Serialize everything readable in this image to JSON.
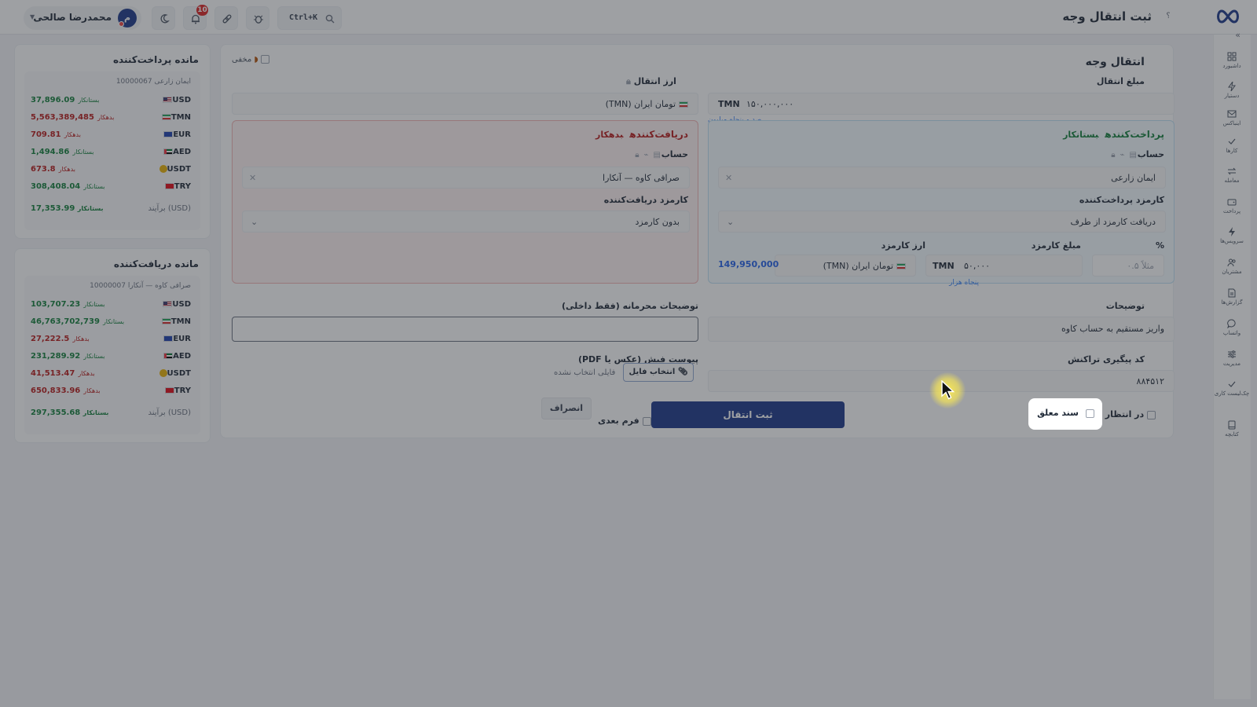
{
  "topbar": {
    "page_title": "ثبت انتقال وجه",
    "help": "؟",
    "search_shortcut": "Ctrl+K",
    "notifications_count": "10",
    "user_name": "محمدرضا صالحی",
    "user_initial": "م"
  },
  "nav": {
    "collapse": "«",
    "items": [
      {
        "label": "داشبورد",
        "icon": "dashboard-icon"
      },
      {
        "label": "دستیار",
        "icon": "bolt-icon"
      },
      {
        "label": "اینباکس",
        "icon": "inbox-icon"
      },
      {
        "label": "کارها",
        "icon": "check-icon"
      },
      {
        "label": "معامله",
        "icon": "exchange-icon"
      },
      {
        "label": "پرداخت",
        "icon": "wallet-icon"
      },
      {
        "label": "سرویس‌ها",
        "icon": "service-icon"
      },
      {
        "label": "مشتریان",
        "icon": "users-icon"
      },
      {
        "label": "گزارش‌ها",
        "icon": "report-icon"
      },
      {
        "label": "واتساپ",
        "icon": "chat-icon"
      },
      {
        "label": "مدیریت",
        "icon": "sliders-icon"
      },
      {
        "label": "چک‌لیست کاری",
        "icon": "checklist-icon"
      },
      {
        "label": "کتابچه",
        "icon": "book-icon"
      }
    ]
  },
  "form": {
    "title": "انتقال وجه",
    "hidden_label": "مخفی",
    "amount_label": "مبلغ انتقال",
    "amount_value": "۱۵۰,۰۰۰,۰۰۰",
    "amount_currency": "TMN",
    "amount_in_words": "صد و پنجاه میلیون",
    "currency_label": "ارز انتقال",
    "currency_value": "تومان ایران (TMN)",
    "payer": {
      "title": "پرداخت‌کننده",
      "status": "بستانکار",
      "account_label": "حساب",
      "account_value": "ایمان زارعی",
      "fee_label": "کارمزد پرداخت‌کننده",
      "fee_value": "دریافت کارمزد از طرف",
      "percent_label": "%",
      "percent_placeholder": "مثلاً ۰.۵",
      "fee_amount_label": "مبلغ کارمزد",
      "fee_amount_value": "۵۰,۰۰۰",
      "fee_amount_currency": "TMN",
      "fee_amount_words": "پنجاه هزار",
      "fee_currency_label": "ارز کارمزد",
      "fee_currency_value": "تومان ایران (TMN)",
      "net_total": "149,950,000"
    },
    "receiver": {
      "title": "دریافت‌کننده",
      "status": "بدهکار",
      "account_label": "حساب",
      "account_value": "صرافی کاوه — آنکارا",
      "fee_label": "کارمزد دریافت‌کننده",
      "fee_value": "بدون کارمزد"
    },
    "desc_label": "توضیحات",
    "desc_value": "واریز مستقیم به حساب کاوه",
    "private_label": "توضیحات محرمانه (فقط داخلی)",
    "private_value": "",
    "tracking_label": "کد پیگیری تراکنش",
    "tracking_value": "۸۸۴۵۱۲",
    "attach_label": "پیوست فیش (عکس یا PDF)",
    "attach_button": "انتخاب فایل",
    "attach_status": "فایلی انتخاب نشده",
    "pending_label": "در انتظار وصول",
    "suspended_label": "سند معلق",
    "submit": "ثبت انتقال",
    "next_form": "فرم بعدی",
    "cancel": "انصراف"
  },
  "payer_balance": {
    "title": "مانده پرداخت‌کننده",
    "subtitle": "ایمان زارعی 10000067",
    "rows": [
      {
        "currency": "USD",
        "flag": "us",
        "amount": "37,896.09",
        "status": "بستانکار",
        "color": "#15803d"
      },
      {
        "currency": "TMN",
        "flag": "ir",
        "amount": "5,563,389,485",
        "status": "بدهکار",
        "color": "#b91c1c"
      },
      {
        "currency": "EUR",
        "flag": "eu",
        "amount": "709.81",
        "status": "بدهکار",
        "color": "#b91c1c"
      },
      {
        "currency": "AED",
        "flag": "ae",
        "amount": "1,494.86",
        "status": "بستانکار",
        "color": "#15803d"
      },
      {
        "currency": "USDT",
        "flag": "coin",
        "amount": "673.8",
        "status": "بدهکار",
        "color": "#b91c1c"
      },
      {
        "currency": "TRY",
        "flag": "tr",
        "amount": "308,408.04",
        "status": "بستانکار",
        "color": "#15803d"
      }
    ],
    "total_label": "برآیند (USD)",
    "total_amount": "17,353.99",
    "total_status": "بستانکار"
  },
  "receiver_balance": {
    "title": "مانده دریافت‌کننده",
    "subtitle": "صرافی کاوه — آنکارا 10000007",
    "rows": [
      {
        "currency": "USD",
        "flag": "us",
        "amount": "103,707.23",
        "status": "بستانکار",
        "color": "#15803d"
      },
      {
        "currency": "TMN",
        "flag": "ir",
        "amount": "46,763,702,739",
        "status": "بستانکار",
        "color": "#15803d"
      },
      {
        "currency": "EUR",
        "flag": "eu",
        "amount": "27,222.5",
        "status": "بدهکار",
        "color": "#b91c1c"
      },
      {
        "currency": "AED",
        "flag": "ae",
        "amount": "231,289.92",
        "status": "بستانکار",
        "color": "#15803d"
      },
      {
        "currency": "USDT",
        "flag": "coin",
        "amount": "41,513.47",
        "status": "بدهکار",
        "color": "#b91c1c"
      },
      {
        "currency": "TRY",
        "flag": "tr",
        "amount": "650,833.96",
        "status": "بدهکار",
        "color": "#b91c1c"
      }
    ],
    "total_label": "برآیند (USD)",
    "total_amount": "297,355.68",
    "total_status": "بستانکار"
  },
  "colors": {
    "primary": "#1e3a8a",
    "creditor": "#15803d",
    "debtor": "#b91c1c",
    "highlight": "#ffec50"
  }
}
